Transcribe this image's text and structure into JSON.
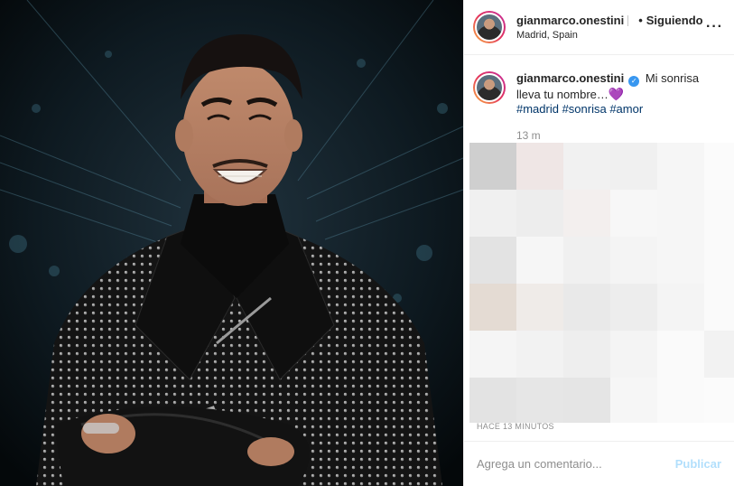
{
  "post": {
    "image_alt": "",
    "header": {
      "username": "gianmarco.onestini",
      "follow_status": "Siguiendo",
      "location": "Madrid, Spain",
      "more_icon": "more-options-icon"
    },
    "caption": {
      "username": "gianmarco.onestini",
      "text": "Mi sonrisa lleva tu nombre…",
      "emoji": "💜",
      "hashtags": "#madrid #sonrisa #amor",
      "time": "13 m"
    },
    "timestamp": "HACE 13 MINUTOS",
    "comment": {
      "placeholder": "Agrega un comentario...",
      "publish_label": "Publicar"
    }
  }
}
